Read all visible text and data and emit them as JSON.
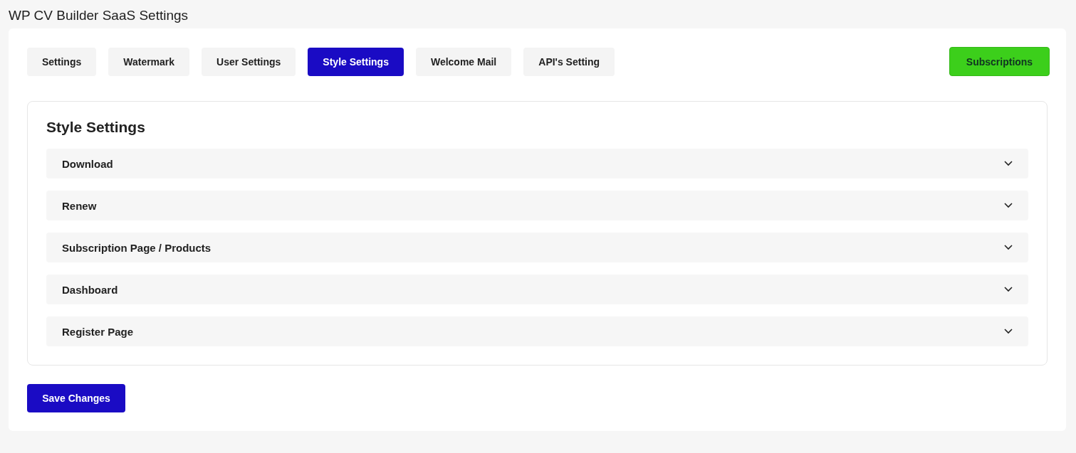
{
  "page_title": "WP CV Builder SaaS Settings",
  "tabs": [
    {
      "label": "Settings",
      "selected": false
    },
    {
      "label": "Watermark",
      "selected": false
    },
    {
      "label": "User Settings",
      "selected": false
    },
    {
      "label": "Style Settings",
      "selected": true
    },
    {
      "label": "Welcome Mail",
      "selected": false
    },
    {
      "label": "API's Setting",
      "selected": false
    }
  ],
  "subscriptions_button": "Subscriptions",
  "section": {
    "heading": "Style Settings",
    "accordion": [
      {
        "label": "Download",
        "expanded": false
      },
      {
        "label": "Renew",
        "expanded": false
      },
      {
        "label": "Subscription Page / Products",
        "expanded": false
      },
      {
        "label": "Dashboard",
        "expanded": false
      },
      {
        "label": "Register Page",
        "expanded": false
      }
    ]
  },
  "save_button": "Save Changes"
}
